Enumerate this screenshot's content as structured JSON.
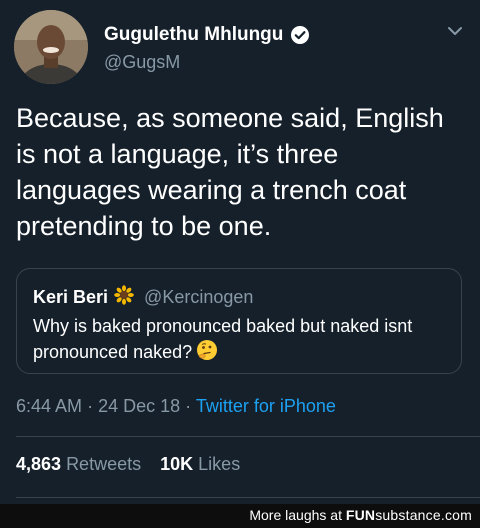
{
  "tweet": {
    "author": {
      "display_name": "Gugulethu Mhlungu",
      "handle": "@GugsM",
      "verified": true
    },
    "text": "Because, as someone said, English is not a language, it’s three languages wearing a trench coat pretending to be one.",
    "quoted": {
      "display_name": "Keri Beri",
      "name_emoji": "sunflower-emoji",
      "handle": "@Kercinogen",
      "text": "Why is baked pronounced baked but naked isnt pronounced naked?",
      "trailing_emoji": "thinking-face-emoji"
    },
    "time": "6:44 AM",
    "date": "24 Dec 18",
    "separator": "·",
    "source": "Twitter for iPhone",
    "retweets_count": "4,863",
    "retweets_label": "Retweets",
    "likes_count": "10K",
    "likes_label": "Likes"
  },
  "footer": {
    "prefix": "More laughs at",
    "brand_bold": "FUN",
    "brand_rest": "substance.com"
  },
  "colors": {
    "background": "#15202b",
    "secondary_text": "#8899a6",
    "link": "#1da1f2",
    "border": "#38444d"
  }
}
